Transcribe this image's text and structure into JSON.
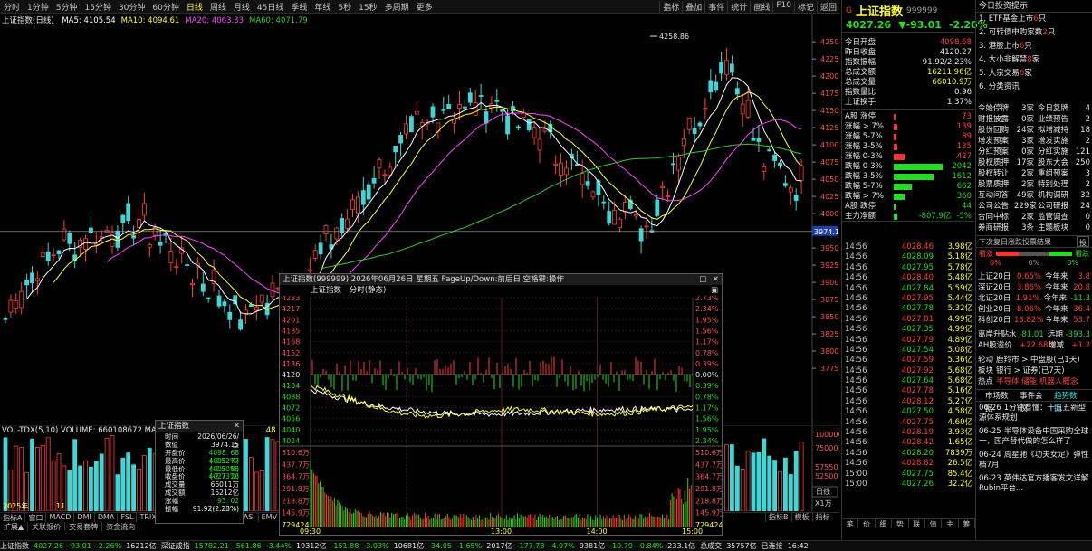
{
  "toolbar": {
    "periods": [
      "分时",
      "1分钟",
      "5分钟",
      "15分钟",
      "30分钟",
      "60分钟",
      "日线",
      "周线",
      "月线",
      "45日线",
      "季线",
      "年线",
      "5秒",
      "15秒",
      "多周期",
      "更多"
    ],
    "active_period": "日线",
    "tools": [
      "指标",
      "叠加",
      "事件",
      "统计",
      "画线",
      "F10",
      "标记",
      "返回"
    ]
  },
  "main": {
    "title": "上证指数(日线)",
    "ma": [
      {
        "label": "MA5: 4105.54",
        "color": "#ffffff"
      },
      {
        "label": "MA10: 4094.61",
        "color": "#ffff33"
      },
      {
        "label": "MA20: 4063.33",
        "color": "#ff44ff"
      },
      {
        "label": "MA60: 4071.79",
        "color": "#33cc33"
      }
    ],
    "y_ticks": [
      "4250",
      "4225",
      "4200",
      "4175",
      "4150",
      "4125",
      "4100",
      "4075",
      "4050",
      "4025",
      "4000",
      "3950",
      "3925",
      "3900",
      "3875",
      "3850",
      "3825",
      "3800",
      "3775"
    ],
    "high_label": "4258.86",
    "cursor_price": "3974.1"
  },
  "volume": {
    "label": "VOL-TDX(5,10)  VOLUME: 660108672  MA5:",
    "extra": "48",
    "y_ticks": [
      "100000",
      "75000",
      "57550",
      "52500",
      "25000",
      "X1万"
    ],
    "year_label": "2025年",
    "month_label": "11"
  },
  "bottom_tabs": [
    "指标A",
    "窗口",
    "MACD",
    "DMI",
    "DMA",
    "FSL",
    "TRIX",
    "BRAR",
    "CR",
    "VR",
    "OBV",
    "ASI",
    "EMV",
    "VOL-TDX"
  ],
  "active_bottom_tab": "VOL-TDX",
  "ctrl_tabs": [
    "扩展▲",
    "关联报价",
    "交易套牌",
    "资金流向"
  ],
  "right_bottom_tabs": [
    "指标B",
    "模板",
    "指标"
  ],
  "date_tab": "日线",
  "statusbar": [
    {
      "t": "上证指数",
      "c": "white"
    },
    {
      "t": "4027.26",
      "c": "green"
    },
    {
      "t": "-93.01",
      "c": "green"
    },
    {
      "t": "-2.26%",
      "c": "green"
    },
    {
      "t": "16212亿",
      "c": "white"
    },
    {
      "t": "深证成指",
      "c": "white"
    },
    {
      "t": "15782.21",
      "c": "green"
    },
    {
      "t": "-561.86",
      "c": "green"
    },
    {
      "t": "-3.44%",
      "c": "green"
    },
    {
      "t": "19312亿",
      "c": "white"
    },
    {
      "t": "-151.88",
      "c": "green"
    },
    {
      "t": "-3.03%",
      "c": "green"
    },
    {
      "t": "10681亿",
      "c": "white"
    },
    {
      "t": "-34.05",
      "c": "green"
    },
    {
      "t": "-1.65%",
      "c": "green"
    },
    {
      "t": "2017亿",
      "c": "white"
    },
    {
      "t": "-177.78",
      "c": "green"
    },
    {
      "t": "-4.07%",
      "c": "green"
    },
    {
      "t": "9381亿",
      "c": "white"
    },
    {
      "t": "-10.79",
      "c": "green"
    },
    {
      "t": "-0.84%",
      "c": "green"
    },
    {
      "t": "233.1亿",
      "c": "white"
    },
    {
      "t": "总成交",
      "c": "white"
    },
    {
      "t": "35757亿",
      "c": "white"
    },
    {
      "t": "已连接",
      "c": "white"
    },
    {
      "t": "16:42",
      "c": "white"
    }
  ],
  "index": {
    "badge": "G",
    "name": "上证指数",
    "code": "999999",
    "price": "4027.26",
    "change": "▼-93.01",
    "pct": "-2.26%",
    "fields": [
      {
        "k": "今日开盘",
        "v": "4098.68",
        "c": "red"
      },
      {
        "k": "昨日收盘",
        "v": "4120.27",
        "c": "white"
      },
      {
        "k": "指数振幅",
        "v": "91.92/2.23%",
        "c": "white"
      },
      {
        "k": "总成交额",
        "v": "16211.96亿",
        "c": "yellow"
      },
      {
        "k": "总成交量",
        "v": "66010.9万",
        "c": "yellow"
      },
      {
        "k": "指数量比",
        "v": "0.96",
        "c": "white"
      },
      {
        "k": "上证换手",
        "v": "1.37%",
        "c": "white"
      }
    ],
    "breadth": [
      {
        "k": "A股 涨停",
        "v": "73",
        "c": "red",
        "w": 2,
        "bc": "#ff3030"
      },
      {
        "k": "涨幅 > 7%",
        "v": "139",
        "c": "red",
        "w": 4,
        "bc": "#ff3030"
      },
      {
        "k": "涨幅 5-7%",
        "v": "89",
        "c": "red",
        "w": 3,
        "bc": "#ff3030"
      },
      {
        "k": "涨幅 3-5%",
        "v": "135",
        "c": "red",
        "w": 4,
        "bc": "#ff3030"
      },
      {
        "k": "涨幅 0-3%",
        "v": "427",
        "c": "red",
        "w": 12,
        "bc": "#ff3030"
      },
      {
        "k": "跌幅 0-3%",
        "v": "2042",
        "c": "green",
        "w": 54,
        "bc": "#22dd22"
      },
      {
        "k": "跌幅 3-5%",
        "v": "1612",
        "c": "green",
        "w": 44,
        "bc": "#22dd22"
      },
      {
        "k": "跌幅 5-7%",
        "v": "662",
        "c": "green",
        "w": 20,
        "bc": "#22dd22"
      },
      {
        "k": "跌幅 > 7%",
        "v": "360",
        "c": "green",
        "w": 12,
        "bc": "#22dd22"
      },
      {
        "k": "A股 跌停",
        "v": "44",
        "c": "green",
        "w": 2,
        "bc": "#22dd22"
      }
    ],
    "netflow_label": "主力净额",
    "netflow_value": "-807.9亿",
    "netflow_pct": "-5%",
    "ticks": [
      [
        "14:56",
        "4028.46",
        "3.98亿"
      ],
      [
        "14:56",
        "4028.09",
        "5.18亿"
      ],
      [
        "14:56",
        "4027.95",
        "5.78亿"
      ],
      [
        "14:56",
        "4028.40",
        "5.48亿"
      ],
      [
        "14:56",
        "4027.84",
        "5.59亿"
      ],
      [
        "14:56",
        "4027.95",
        "5.44亿"
      ],
      [
        "14:56",
        "4027.78",
        "5.32亿"
      ],
      [
        "14:56",
        "4027.81",
        "4.99亿"
      ],
      [
        "14:56",
        "4027.35",
        "4.99亿"
      ],
      [
        "14:56",
        "4027.79",
        "4.89亿"
      ],
      [
        "14:56",
        "4027.54",
        "5.08亿"
      ],
      [
        "14:56",
        "4027.59",
        "5.36亿"
      ],
      [
        "14:56",
        "4027.92",
        "5.68亿"
      ],
      [
        "14:56",
        "4027.64",
        "5.68亿"
      ],
      [
        "14:56",
        "4027.78",
        "5.16亿"
      ],
      [
        "14:56",
        "4028.12",
        "5.27亿"
      ],
      [
        "14:56",
        "4027.50",
        "4.58亿"
      ],
      [
        "14:56",
        "4027.75",
        "4.60亿"
      ],
      [
        "14:56",
        "4028.19",
        "3.93亿"
      ],
      [
        "14:56",
        "4028.42",
        "1.65亿"
      ],
      [
        "14:56",
        "4028.20",
        "7839万"
      ],
      [
        "14:56",
        "4028.82",
        "26.5亿"
      ],
      [
        "15:00",
        "4027.75",
        "85.4亿"
      ],
      [
        "15:00",
        "4027.26",
        "32.2亿"
      ]
    ],
    "tick_colors": [
      "red",
      "green",
      "green",
      "red",
      "green",
      "red",
      "green",
      "red",
      "green",
      "red",
      "green",
      "red",
      "red",
      "green",
      "red",
      "red",
      "green",
      "red",
      "red",
      "red",
      "green",
      "red",
      "green",
      "green"
    ],
    "tabs": [
      "笔",
      "价",
      "细",
      "势",
      "联",
      "值",
      "主",
      "筹"
    ]
  },
  "news": {
    "header": "今日投资提示",
    "items": [
      {
        "n": "1. ETF基金上市",
        "h": "6",
        "s": "只"
      },
      {
        "n": "2. 可转债申购家数",
        "h": "2",
        "s": "只"
      },
      {
        "n": "3. 港股上市",
        "h": "6",
        "s": "只"
      },
      {
        "n": "4. 大小非解禁",
        "h": "8",
        "s": "家"
      },
      {
        "n": "5. 大宗交易",
        "h": "6",
        "s": "家"
      },
      {
        "n": "6. 分类资讯",
        "h": "",
        "s": ""
      }
    ],
    "grid": [
      [
        "今始停牌",
        "3家",
        "今日复牌",
        "4"
      ],
      [
        "财报披露",
        "0家",
        "业绩预告",
        "2"
      ],
      [
        "股份回购",
        "24家",
        "拟增减持",
        "18"
      ],
      [
        "增发预案",
        "3家",
        "增发实施",
        "2"
      ],
      [
        "分红预案",
        "0家",
        "分红实施",
        "121"
      ],
      [
        "股权质押",
        "17家",
        "股东大会",
        "250"
      ],
      [
        "股权转让",
        "2家",
        "重组预案",
        "3"
      ],
      [
        "股票质押",
        "2家",
        "特别处理",
        "2"
      ],
      [
        "互动问答",
        "49家",
        "机构调研",
        "32"
      ],
      [
        "公司公告",
        "229家",
        "公司研报",
        "24"
      ],
      [
        "合同中标",
        "2家",
        "监管调查",
        "0"
      ],
      [
        "券商研报",
        "3条",
        "主题板块",
        "0"
      ]
    ],
    "promo": "下次复日涨跌投票结果",
    "promo_tab": "投",
    "vote_labels": [
      "看涨",
      "看跌"
    ],
    "vote_pcts": [
      "0%",
      "0%",
      "0%"
    ],
    "perf": [
      {
        "n": "上证20日",
        "a": "0.65%",
        "b": "今年来",
        "c": "3.8"
      },
      {
        "n": "深证20日",
        "a": "3.86%",
        "b": "今年来",
        "c": "20.8"
      },
      {
        "n": "北证20日",
        "a": "1.91%",
        "b": "今年来",
        "c": "-11.3"
      },
      {
        "n": "创业20日",
        "a": "8.06%",
        "b": "今年来",
        "c": "36.4"
      },
      {
        "n": "科创20日",
        "a": "13.82%",
        "b": "今年来",
        "c": "53.7"
      }
    ],
    "signals": [
      {
        "k": "离岸升贴水",
        "a": "-81.01",
        "b": "远期",
        "c": "-393.3"
      },
      {
        "k": "AH股溢价",
        "a": "+22.68%",
        "b": "增减",
        "c": "+1.2"
      }
    ],
    "hot": [
      {
        "k": "轮动",
        "v": "鹿羚市 > 中盘股(已1天)"
      },
      {
        "k": "板块",
        "v": "银行 > 证券(已7天)"
      },
      {
        "k": "热点",
        "v": "半导体 储能 机器人概念"
      }
    ],
    "subtabs": [
      "市场数据",
      "事件会议",
      "趋势数据"
    ],
    "headlines": [
      {
        "d": "06-26",
        "t": "1分钟看懂：十五五新型",
        "t2": "源体系规划"
      },
      {
        "d": "06-25",
        "t": "半导体设备中国采购全球",
        "t2": "一，国产替代做的怎么样了"
      },
      {
        "d": "06-24",
        "t": "周星驰《功夫女足》弹性",
        "t2": "档7月"
      },
      {
        "d": "06-23",
        "t": "英伟达官方播客发文详解",
        "t2": "Rubin平台..."
      }
    ]
  },
  "popup": {
    "title": "上证指数(999999) 2026年06月26日 星期五 PageUp/Down:前后日 空格键:操作",
    "sub_name": "上证指数",
    "sub_mode": "分时(静态)",
    "left_ticks": [
      "4233",
      "4217",
      "4201",
      "4185",
      "4168",
      "4152",
      "4136",
      "4120",
      "4104",
      "4088",
      "4072",
      "4056",
      "4040",
      "4024"
    ],
    "right_ticks": [
      "2.73%",
      "2.34%",
      "1.95%",
      "1.56%",
      "1.17%",
      "0.78%",
      "0.39%",
      "0.00%",
      "0.39%",
      "0.78%",
      "1.17%",
      "1.56%",
      "1.95%",
      "2.34%"
    ],
    "vol_ticks": [
      "510.6万",
      "437.7万",
      "364.7万",
      "291.8万",
      "218.8万",
      "145.9万",
      "729424"
    ],
    "time_ticks": [
      "09:30",
      "13:00",
      "14:00",
      "15:00"
    ]
  },
  "tooltip": {
    "title": "上证指数",
    "rows": [
      {
        "k": "时间",
        "v": "2026/06/26/五",
        "c": "white"
      },
      {
        "k": "数值",
        "v": "3974.15",
        "c": "white"
      },
      {
        "k": "开盘价",
        "v": "4098. 68 (-0.52%)",
        "c": "green"
      },
      {
        "k": "最高价",
        "v": "4099. 77 (-0.50%)",
        "c": "green"
      },
      {
        "k": "最低价",
        "v": "4007. 85 (-2.73%)",
        "c": "green"
      },
      {
        "k": "收盘价",
        "v": "4027. 26",
        "c": "green"
      },
      {
        "k": "成交量",
        "v": "66011万",
        "c": "white"
      },
      {
        "k": "成交额",
        "v": "16212亿",
        "c": "white"
      },
      {
        "k": "涨幅",
        "v": "-93. 02 (-2.26%)",
        "c": "green"
      },
      {
        "k": "振幅",
        "v": "91.92(2.23%)",
        "c": "white"
      }
    ]
  }
}
